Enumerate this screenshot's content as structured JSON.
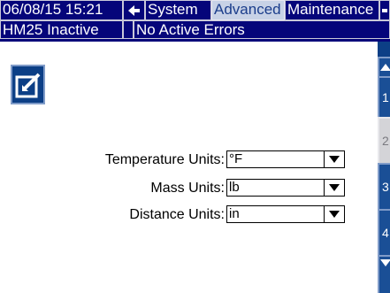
{
  "header": {
    "datetime": "06/08/15 15:21",
    "tabs": [
      {
        "label": "System",
        "selected": false
      },
      {
        "label": "Advanced",
        "selected": true
      },
      {
        "label": "Maintenance",
        "selected": false
      }
    ],
    "status": "HM25 Inactive",
    "errors": "No Active Errors"
  },
  "form": {
    "rows": [
      {
        "label": "Temperature Units:",
        "value": "°F"
      },
      {
        "label": "Mass Units:",
        "value": "lb"
      },
      {
        "label": "Distance Units:",
        "value": "in"
      }
    ]
  },
  "sidebar": {
    "tabs": [
      {
        "label": "1",
        "active": false
      },
      {
        "label": "2",
        "active": true
      },
      {
        "label": "3",
        "active": false
      },
      {
        "label": "4",
        "active": false
      }
    ]
  },
  "icons": {
    "back": "back-arrow-icon",
    "edit": "edit-icon",
    "scroll_up": "scroll-up-icon",
    "scroll_down": "scroll-down-icon"
  },
  "colors": {
    "header_bg": "#05057a",
    "selected_tab_bg": "#c8d2e6",
    "sidebar_bg": "#0c3f86",
    "sidebar_active": "#d4d4d8"
  }
}
